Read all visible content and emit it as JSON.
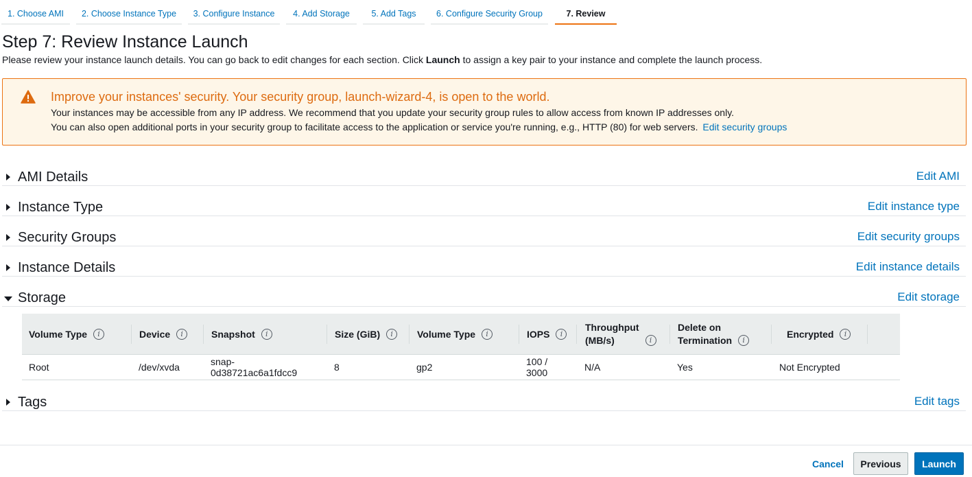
{
  "steps": [
    {
      "label": "1. Choose AMI"
    },
    {
      "label": "2. Choose Instance Type"
    },
    {
      "label": "3. Configure Instance"
    },
    {
      "label": "4. Add Storage"
    },
    {
      "label": "5. Add Tags"
    },
    {
      "label": "6. Configure Security Group"
    },
    {
      "label": "7. Review"
    }
  ],
  "page": {
    "title": "Step 7: Review Instance Launch",
    "desc_before": "Please review your instance launch details. You can go back to edit changes for each section. Click ",
    "desc_bold": "Launch",
    "desc_after": " to assign a key pair to your instance and complete the launch process."
  },
  "alert": {
    "icon": "warning-icon",
    "title": "Improve your instances' security. Your security group, launch-wizard-4, is open to the world.",
    "line1": "Your instances may be accessible from any IP address. We recommend that you update your security group rules to allow access from known IP addresses only.",
    "line2": "You can also open additional ports in your security group to facilitate access to the application or service you're running, e.g., HTTP (80) for web servers.",
    "link": "Edit security groups"
  },
  "sections": {
    "ami": {
      "title": "AMI Details",
      "edit": "Edit AMI"
    },
    "instance_type": {
      "title": "Instance Type",
      "edit": "Edit instance type"
    },
    "security_groups": {
      "title": "Security Groups",
      "edit": "Edit security groups"
    },
    "instance_details": {
      "title": "Instance Details",
      "edit": "Edit instance details"
    },
    "storage": {
      "title": "Storage",
      "edit": "Edit storage"
    },
    "tags": {
      "title": "Tags",
      "edit": "Edit tags"
    }
  },
  "storage_table": {
    "headers": {
      "volume_type": "Volume Type",
      "device": "Device",
      "snapshot": "Snapshot",
      "size": "Size (GiB)",
      "volume_type2": "Volume Type",
      "iops": "IOPS",
      "throughput_l1": "Throughput",
      "throughput_l2": "(MB/s)",
      "delete_l1": "Delete on",
      "delete_l2": "Termination",
      "encrypted": "Encrypted"
    },
    "info_glyph": "i",
    "row": {
      "volume_type": "Root",
      "device": "/dev/xvda",
      "snapshot_l1": "snap-",
      "snapshot_l2": "0d38721ac6a1fdcc9",
      "size": "8",
      "volume_type2": "gp2",
      "iops_l1": "100 /",
      "iops_l2": "3000",
      "throughput": "N/A",
      "delete_on_termination": "Yes",
      "encrypted": "Not Encrypted"
    }
  },
  "footer": {
    "cancel": "Cancel",
    "previous": "Previous",
    "launch": "Launch"
  },
  "colors": {
    "link": "#0073bb",
    "accent": "#ec7211",
    "warning_text": "#dd6b10",
    "warning_bg": "#fef6e8",
    "primary_button": "#0073bb"
  }
}
